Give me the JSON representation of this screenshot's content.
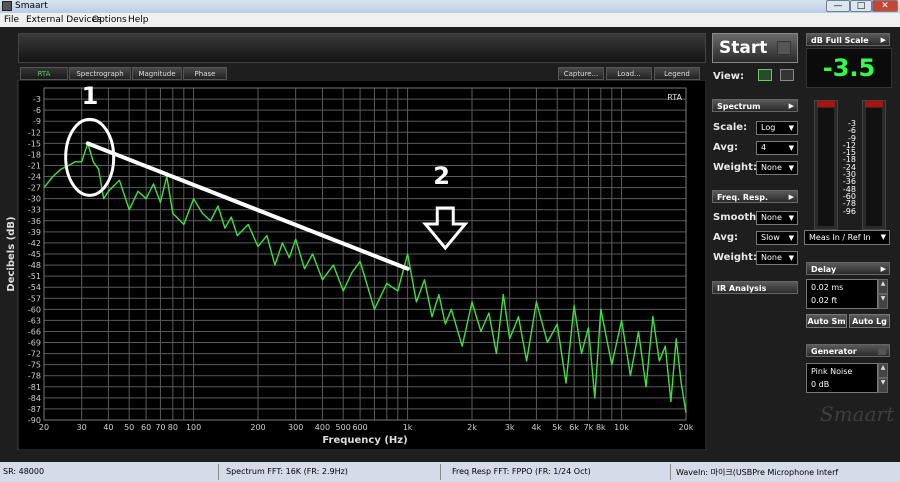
{
  "window": {
    "title": "Smaart",
    "min": "—",
    "max": "□",
    "close": "✕"
  },
  "menu": [
    "File",
    "External Devices",
    "Options",
    "Help"
  ],
  "tabs": [
    "RTA",
    "Spectrograph",
    "Magnitude",
    "Phase"
  ],
  "right_tabs": [
    "Capture...",
    "Load...",
    "Legend"
  ],
  "plot": {
    "mode_label": "RTA",
    "annotations": {
      "label1": "1",
      "label2": "2"
    }
  },
  "chart_data": {
    "type": "line",
    "xlabel": "Frequency (Hz)",
    "ylabel": "Decibels (dB)",
    "x_scale": "log",
    "xlim": [
      20,
      20000
    ],
    "ylim": [
      -90,
      0
    ],
    "x_ticks": [
      "20",
      "30",
      "40",
      "50",
      "60",
      "70",
      "80",
      "100",
      "200",
      "300",
      "400",
      "500",
      "600",
      "1k",
      "2k",
      "3k",
      "4k",
      "5k",
      "6k",
      "7k",
      "8k",
      "10k",
      "20k"
    ],
    "x_tick_values": [
      20,
      30,
      40,
      50,
      60,
      70,
      80,
      100,
      200,
      300,
      400,
      500,
      600,
      1000,
      2000,
      3000,
      4000,
      5000,
      6000,
      7000,
      8000,
      10000,
      20000
    ],
    "y_ticks": [
      "-3",
      "-6",
      "-9",
      "-12",
      "-15",
      "-18",
      "-21",
      "-24",
      "-27",
      "-30",
      "-33",
      "-36",
      "-39",
      "-42",
      "-45",
      "-48",
      "-51",
      "-54",
      "-57",
      "-60",
      "-63",
      "-66",
      "-69",
      "-72",
      "-75",
      "-78",
      "-81",
      "-84",
      "-87",
      "-90"
    ],
    "y_tick_values": [
      -3,
      -6,
      -9,
      -12,
      -15,
      -18,
      -21,
      -24,
      -27,
      -30,
      -33,
      -36,
      -39,
      -42,
      -45,
      -48,
      -51,
      -54,
      -57,
      -60,
      -63,
      -66,
      -69,
      -72,
      -75,
      -78,
      -81,
      -84,
      -87,
      -90
    ],
    "grid": true,
    "series": [
      {
        "color": "#3fe03f",
        "x": [
          20,
          22,
          24,
          26,
          28,
          30,
          32,
          34,
          36,
          38,
          40,
          45,
          50,
          55,
          60,
          65,
          70,
          75,
          80,
          90,
          100,
          110,
          120,
          130,
          140,
          150,
          160,
          180,
          200,
          220,
          240,
          260,
          280,
          300,
          330,
          360,
          400,
          450,
          500,
          550,
          600,
          700,
          800,
          900,
          1000,
          1100,
          1200,
          1300,
          1400,
          1500,
          1600,
          1800,
          2000,
          2200,
          2400,
          2600,
          2800,
          3000,
          3300,
          3600,
          4000,
          4500,
          5000,
          5500,
          6000,
          6500,
          7000,
          7500,
          8000,
          9000,
          10000,
          11000,
          12000,
          13000,
          14000,
          15000,
          16000,
          17000,
          18000,
          19000,
          20000
        ],
        "y": [
          -27,
          -24,
          -22,
          -21,
          -20,
          -20,
          -15,
          -20,
          -22,
          -30,
          -28,
          -25,
          -33,
          -28,
          -30,
          -26,
          -31,
          -24,
          -34,
          -37,
          -30,
          -34,
          -36,
          -32,
          -38,
          -35,
          -40,
          -37,
          -43,
          -40,
          -48,
          -42,
          -46,
          -41,
          -49,
          -45,
          -52,
          -48,
          -55,
          -50,
          -47,
          -60,
          -53,
          -55,
          -45,
          -58,
          -52,
          -62,
          -56,
          -64,
          -60,
          -70,
          -58,
          -66,
          -61,
          -72,
          -56,
          -68,
          -62,
          -74,
          -58,
          -69,
          -64,
          -80,
          -59,
          -72,
          -65,
          -84,
          -60,
          -75,
          -63,
          -78,
          -66,
          -81,
          -62,
          -74,
          -70,
          -85,
          -68,
          -80,
          -88
        ]
      }
    ],
    "overlay_line": {
      "x": [
        32,
        1000
      ],
      "y": [
        -15,
        -49
      ]
    },
    "arrow_at_x": 1500
  },
  "sidebar": {
    "start_label": "Start",
    "view_label": "View:",
    "spectrum_head": "Spectrum",
    "scale_label": "Scale:",
    "scale_value": "Log",
    "avg_label": "Avg:",
    "avg_value": "4",
    "weight_label": "Weight:",
    "weight_value": "None",
    "freq_head": "Freq. Resp.",
    "smooth_label": "Smooth:",
    "smooth_value": "None",
    "avg2_label": "Avg:",
    "avg2_value": "Slow",
    "weight2_label": "Weight:",
    "weight2_value": "None",
    "ir_head": "IR Analysis"
  },
  "levels": {
    "dbfs_head": "dB Full Scale",
    "dbfs_value": "-3.5",
    "scale": [
      "-3",
      "-6",
      "-9",
      "-12",
      "-15",
      "-18",
      "-24",
      "-30",
      "-36",
      "-48",
      "-60",
      "-78",
      "-96"
    ],
    "input_select": "Meas In / Ref In",
    "delay_head": "Delay",
    "delay_ms": "0.02 ms",
    "delay_ft": "0.02 ft",
    "auto_sm": "Auto Sm",
    "auto_lg": "Auto Lg",
    "generator_head": "Generator",
    "gen_type": "Pink Noise",
    "gen_level": "0 dB",
    "logo": "Smaart"
  },
  "status": {
    "sr": "SR: 48000",
    "spectrum_fft": "Spectrum FFT: 16K (FR: 2.9Hz)",
    "freq_resp_fft": "Freq Resp FFT: FPPO (FR: 1/24 Oct)",
    "wave_in": "WaveIn: 마이크(USBPre Microphone Interf"
  },
  "colors": {
    "trace": "#3fe03f",
    "readout": "#33ff44",
    "grid": "#5a5a5a"
  }
}
